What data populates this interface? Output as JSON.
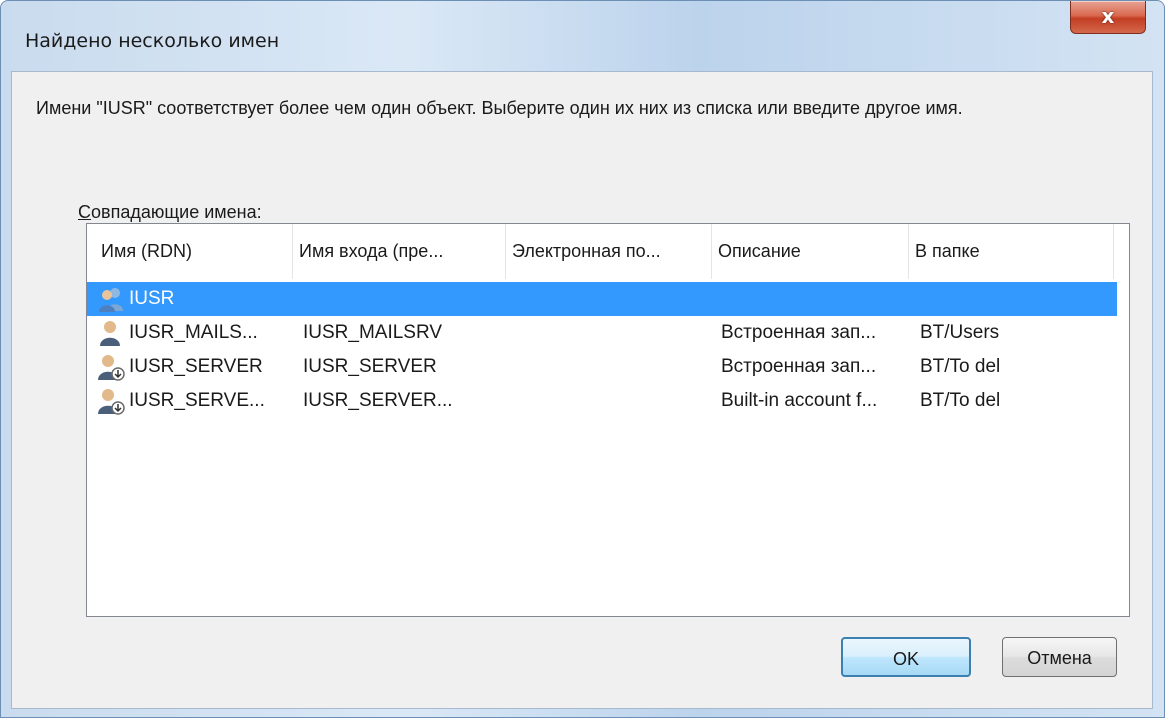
{
  "window": {
    "title": "Найдено несколько имен",
    "close_label": "x"
  },
  "message": "Имени \"IUSR\" соответствует более чем один объект. Выберите один их них из списка или введите другое имя.",
  "list_label_accel": "С",
  "list_label_rest": "овпадающие имена:",
  "columns": [
    "Имя (RDN)",
    "Имя входа (пре...",
    "Электронная по...",
    "Описание",
    "В папке"
  ],
  "rows": [
    {
      "icon": "user-group-icon",
      "name": "IUSR",
      "login": "",
      "email": "",
      "description": "",
      "folder": "",
      "selected": true
    },
    {
      "icon": "user-icon",
      "name": "IUSR_MAILS...",
      "login": "IUSR_MAILSRV",
      "email": "",
      "description": "Встроенная зап...",
      "folder": "BT/Users",
      "selected": false
    },
    {
      "icon": "disabled-user-icon",
      "name": "IUSR_SERVER",
      "login": "IUSR_SERVER",
      "email": "",
      "description": "Встроенная зап...",
      "folder": "BT/To del",
      "selected": false
    },
    {
      "icon": "disabled-user-icon",
      "name": "IUSR_SERVE...",
      "login": "IUSR_SERVER...",
      "email": "",
      "description": "Built-in account f...",
      "folder": "BT/To del",
      "selected": false
    }
  ],
  "buttons": {
    "ok": "OK",
    "cancel": "Отмена"
  },
  "colors": {
    "selection": "#3399ff",
    "close_button": "#c23e23"
  }
}
